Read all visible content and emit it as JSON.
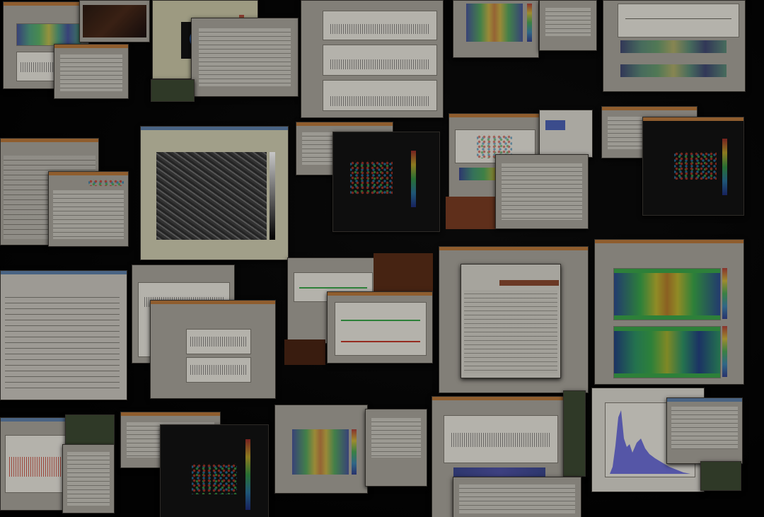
{
  "desktop": {
    "windows": [
      {
        "id": "w01",
        "kind": "spectrogram"
      },
      {
        "id": "w02",
        "kind": "colormap"
      },
      {
        "id": "w03",
        "kind": "timeseries"
      },
      {
        "id": "w04",
        "kind": "spectrogram"
      },
      {
        "id": "w05",
        "kind": "timeseries"
      },
      {
        "id": "w06",
        "kind": "table"
      },
      {
        "id": "w07",
        "kind": "image-viewer"
      },
      {
        "id": "w08",
        "kind": "scatter"
      },
      {
        "id": "w09",
        "kind": "plot"
      },
      {
        "id": "w10",
        "kind": "scatter"
      },
      {
        "id": "w11",
        "kind": "text-editor"
      },
      {
        "id": "w12",
        "kind": "timeseries"
      },
      {
        "id": "w13",
        "kind": "timeseries"
      },
      {
        "id": "w14",
        "kind": "table"
      },
      {
        "id": "w15",
        "kind": "heatmap"
      },
      {
        "id": "w16",
        "kind": "timeseries"
      },
      {
        "id": "w17",
        "kind": "scatter"
      },
      {
        "id": "w18",
        "kind": "spectrogram"
      },
      {
        "id": "w19",
        "kind": "plot"
      },
      {
        "id": "w20",
        "kind": "histogram"
      }
    ]
  },
  "colors": {
    "background": "#050505",
    "window_body": "#a7a39a",
    "title_bar": "#b8783c",
    "title_bar_alt": "#5e7fa8",
    "histogram_fill": "#6d6fd6",
    "series_red": "#c0392b",
    "series_green": "#3aa54a",
    "series_blue": "#2c7fb0"
  }
}
